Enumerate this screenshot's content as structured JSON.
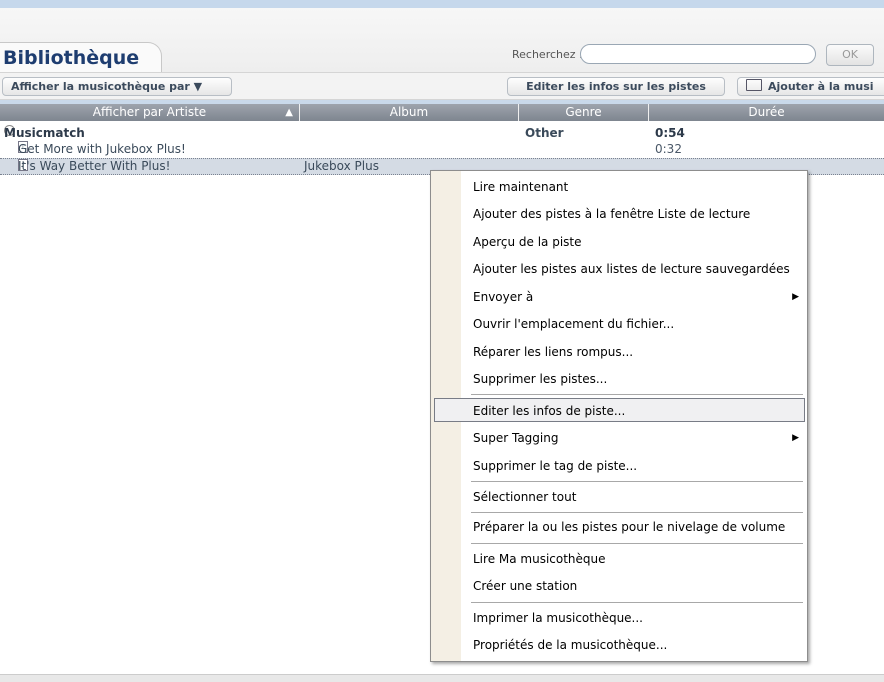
{
  "header": {
    "title": "Bibliothèque",
    "search_label": "Recherchez :",
    "search_value": "",
    "ok_label": "OK"
  },
  "toolbar": {
    "view_by_label": "Afficher la musicothèque par ▼",
    "edit_info_label": "Editer les infos sur les pistes",
    "add_label": "Ajouter à la musi",
    "add_icon": "folder-open-icon"
  },
  "columns": {
    "artist": "Afficher par Artiste",
    "album": "Album",
    "genre": "Genre",
    "duration": "Durée",
    "sort_indicator": "▲"
  },
  "rows": [
    {
      "artist": "Musicmatch",
      "album": "",
      "genre": "Other",
      "duration": "0:54",
      "icon": "globe-icon"
    },
    {
      "artist": "Get More with Jukebox Plus!",
      "album": "",
      "genre": "",
      "duration": "0:32",
      "icon": "music-note-icon"
    },
    {
      "artist": "It's Way Better With Plus!",
      "album": "Jukebox Plus",
      "genre": "",
      "duration": "",
      "icon": "music-note-icon"
    }
  ],
  "context_menu": {
    "items": [
      "Lire maintenant",
      "Ajouter des pistes à la fenêtre Liste de lecture",
      "Aperçu de la piste",
      "Ajouter les pistes aux listes de lecture sauvegardées",
      "Envoyer à",
      "Ouvrir l'emplacement du fichier...",
      "Réparer les liens rompus...",
      "Supprimer les pistes...",
      "Editer les infos de piste...",
      "Super Tagging",
      "Supprimer le tag de piste...",
      "Sélectionner tout",
      "Préparer la ou les pistes pour le nivelage de volume",
      "Lire Ma musicothèque",
      "Créer une station",
      "Imprimer la musicothèque...",
      "Propriétés de la musicothèque..."
    ],
    "submenu_arrow": "▶",
    "highlighted_item": "Editer les infos de piste..."
  }
}
